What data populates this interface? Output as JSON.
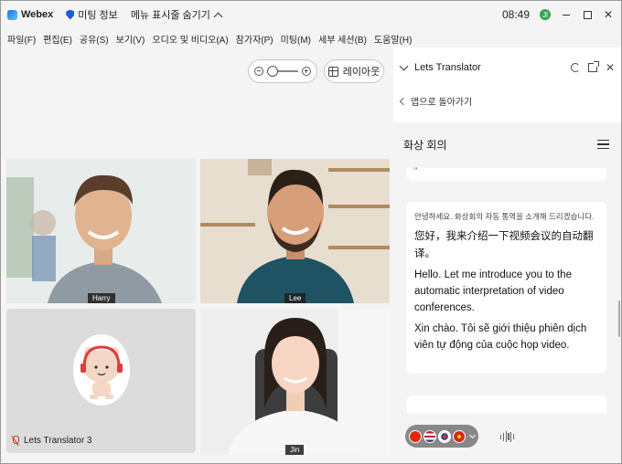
{
  "titlebar": {
    "app_name": "Webex",
    "meeting_info": "미팅 정보",
    "hide_menu": "메뉴 표시줄 숨기기",
    "clock": "08:49",
    "user_initial": "Jl"
  },
  "menubar": {
    "items": [
      "파일(F)",
      "편집(E)",
      "공유(S)",
      "보기(V)",
      "오디오 및 비디오(A)",
      "참가자(P)",
      "미팅(M)",
      "세부 세션(B)",
      "도움말(H)"
    ]
  },
  "view_controls": {
    "layout_label": "레이아웃"
  },
  "participants": [
    {
      "name": "Harry"
    },
    {
      "name": "Lee"
    },
    {
      "name": "Lets Translator 3"
    },
    {
      "name": "Jin"
    }
  ],
  "panel": {
    "title": "Lets Translator",
    "back_label": "앱으로 돌아가기",
    "section_title": "화상 회의",
    "prev_card_text": "\"",
    "message": {
      "korean": "안녕하세요. 화상회의 자동 통역을 소개해 드리겠습니다.",
      "chinese": "您好，我来介绍一下视频会议的自动翻译。",
      "english": "Hello. Let me introduce you to the automatic interpretation of video conferences.",
      "vietnamese": "Xin chào. Tôi sẽ giới thiệu phiên dịch viên tự động của cuộc họp video."
    },
    "languages": [
      "chinese",
      "english-us",
      "korean",
      "vietnamese"
    ]
  },
  "colors": {
    "accent": "#1d5bd6",
    "panel_bg": "#f4f4f4",
    "card_bg": "#ffffff",
    "status_green": "#2fa84f"
  }
}
